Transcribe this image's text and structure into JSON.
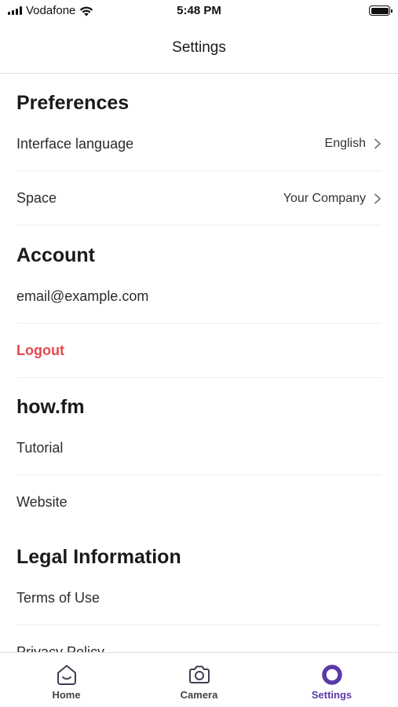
{
  "status_bar": {
    "carrier": "Vodafone",
    "time": "5:48 PM",
    "battery_level": 1.0
  },
  "header": {
    "title": "Settings"
  },
  "sections": {
    "preferences": {
      "title": "Preferences",
      "interface_language": {
        "label": "Interface language",
        "value": "English"
      },
      "space": {
        "label": "Space",
        "value": "Your Company"
      }
    },
    "account": {
      "title": "Account",
      "email": "email@example.com",
      "logout": "Logout"
    },
    "howfm": {
      "title": "how.fm",
      "tutorial": "Tutorial",
      "website": "Website"
    },
    "legal": {
      "title": "Legal Information",
      "terms": "Terms of Use",
      "privacy": "Privacy Policy"
    }
  },
  "tab_bar": {
    "tabs": [
      {
        "label": "Home",
        "icon": "home-icon"
      },
      {
        "label": "Camera",
        "icon": "camera-icon"
      },
      {
        "label": "Settings",
        "icon": "settings-icon",
        "active": true
      }
    ]
  },
  "colors": {
    "accent": "#5b3aa8",
    "logout": "#e5484d",
    "divider": "#eeeeee"
  }
}
